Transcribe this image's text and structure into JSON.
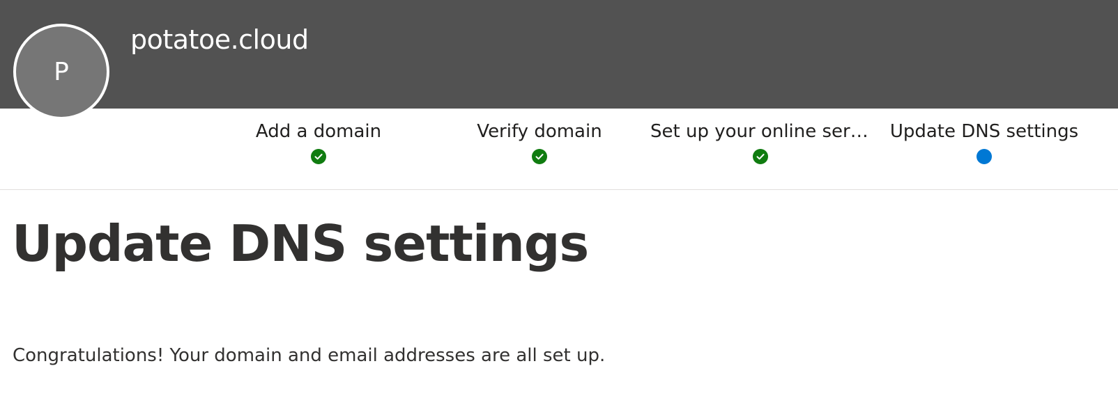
{
  "header": {
    "avatar_initial": "P",
    "site_name": "potatoe.cloud",
    "background_color": "#525252"
  },
  "stepper": {
    "steps": [
      {
        "label": "Add a domain",
        "status": "complete",
        "icon": "check-circle-icon"
      },
      {
        "label": "Verify domain",
        "status": "complete",
        "icon": "check-circle-icon"
      },
      {
        "label": "Set up your online services",
        "status": "complete",
        "icon": "check-circle-icon"
      },
      {
        "label": "Update DNS settings",
        "status": "current",
        "icon": "current-step-dot-icon"
      }
    ],
    "complete_color": "#107c10",
    "current_color": "#0078d4"
  },
  "main": {
    "title": "Update DNS settings",
    "message": "Congratulations! Your domain and email addresses are all set up."
  }
}
